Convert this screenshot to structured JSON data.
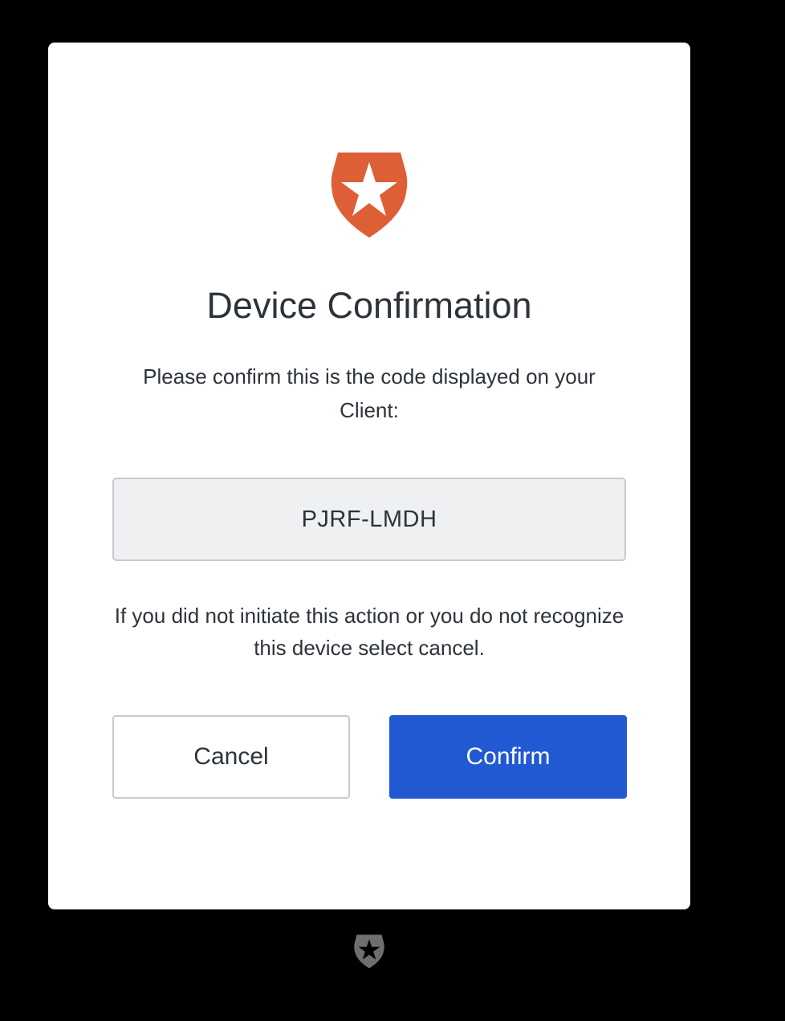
{
  "dialog": {
    "logo_icon": "auth0-shield-icon",
    "title": "Device Confirmation",
    "instruction": "Please confirm this is the code displayed on your Client:",
    "code": "PJRF-LMDH",
    "warning": "If you did not initiate this action or you do not recognize this device select cancel.",
    "cancel_label": "Cancel",
    "confirm_label": "Confirm"
  },
  "footer": {
    "logo_icon": "auth0-shield-icon"
  },
  "colors": {
    "brand_orange": "#dd5f36",
    "primary_blue": "#2159d3",
    "background": "#000000",
    "card": "#ffffff",
    "footer_logo": "#6e6e6e"
  }
}
